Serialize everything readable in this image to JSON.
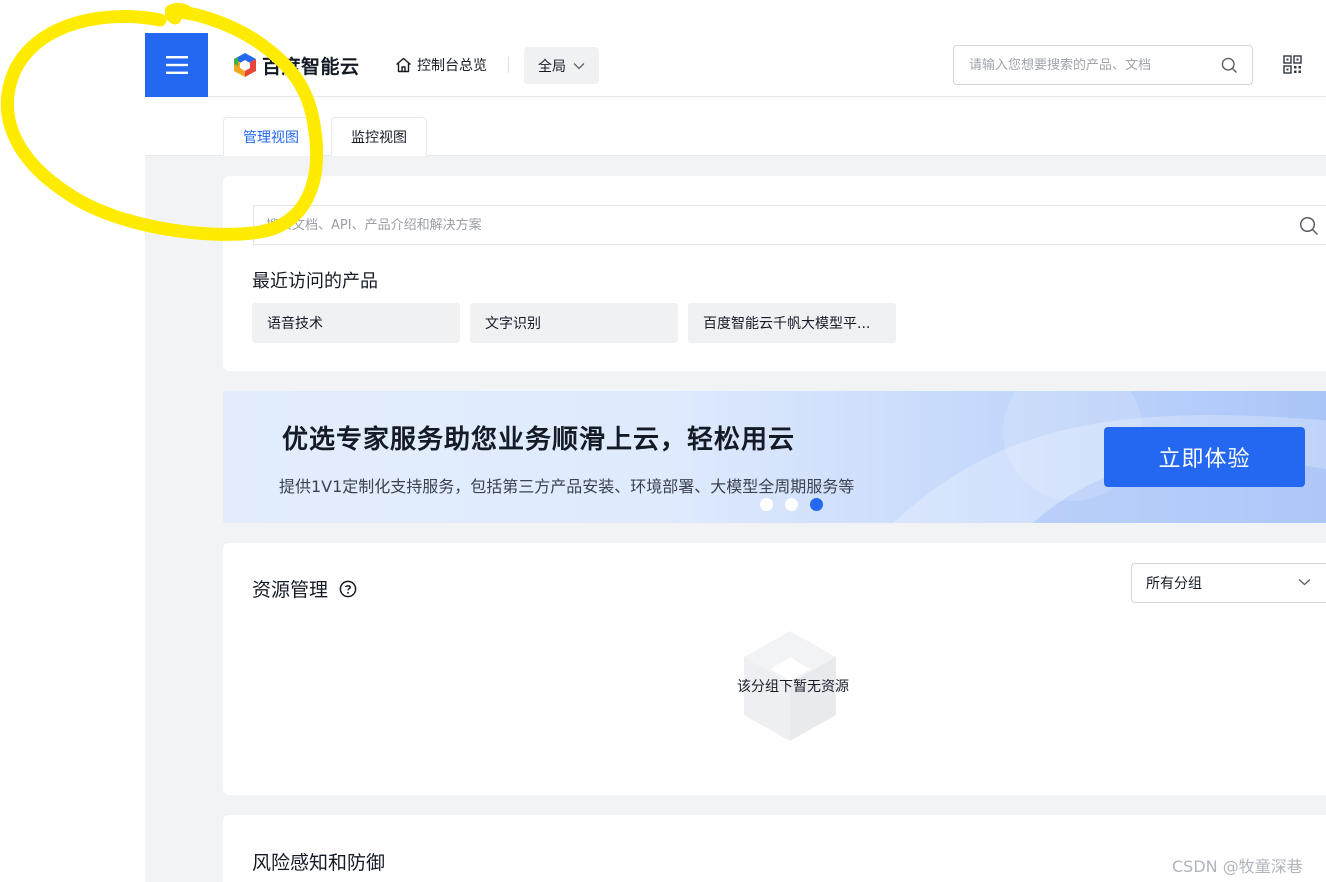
{
  "header": {
    "menu_icon": "hamburger-menu-icon",
    "brand_name": "百度智能云",
    "home_label": "控制台总览",
    "region_label": "全局",
    "search_placeholder": "请输入您想要搜索的产品、文档",
    "accent_color": "#2468f2"
  },
  "tabs": [
    {
      "label": "管理视图",
      "active": true
    },
    {
      "label": "监控视图",
      "active": false
    }
  ],
  "doc_search": {
    "placeholder": "搜索文档、API、产品介绍和解决方案"
  },
  "recent": {
    "title": "最近访问的产品",
    "items": [
      "语音技术",
      "文字识别",
      "百度智能云千帆大模型平..."
    ]
  },
  "banner": {
    "title": "优选专家服务助您业务顺滑上云，轻松用云",
    "subtitle": "提供1V1定制化支持服务，包括第三方产品安装、环境部署、大模型全周期服务等",
    "button_label": "立即体验",
    "active_dot": 3,
    "dot_count": 3
  },
  "resources": {
    "title": "资源管理",
    "group_select": "所有分组",
    "empty_text": "该分组下暂无资源"
  },
  "risk": {
    "title": "风险感知和防御"
  },
  "watermark": "CSDN @牧童深巷",
  "annotation_color": "#ffeb00"
}
